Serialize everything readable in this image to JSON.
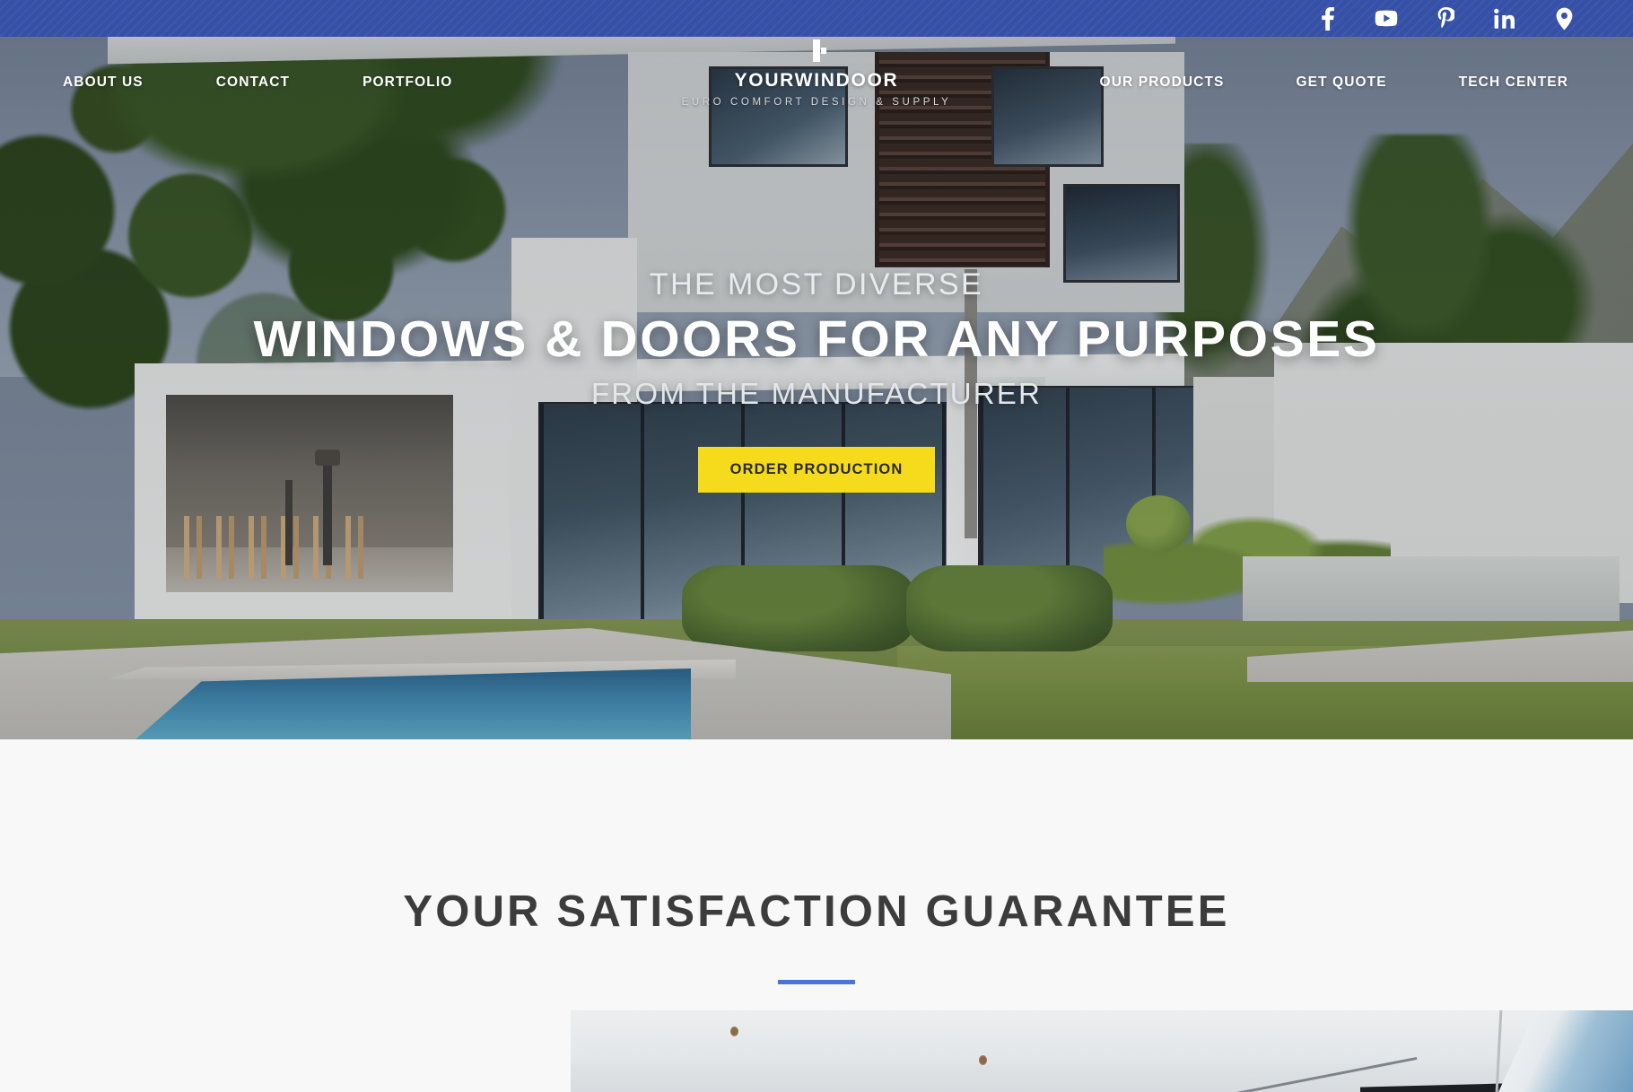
{
  "topbar": {
    "background_color": "#3550A6",
    "social_links": [
      {
        "name": "facebook-icon",
        "label": "Facebook"
      },
      {
        "name": "youtube-icon",
        "label": "YouTube"
      },
      {
        "name": "pinterest-icon",
        "label": "Pinterest"
      },
      {
        "name": "linkedin-icon",
        "label": "LinkedIn"
      },
      {
        "name": "location-pin-icon",
        "label": "Location"
      }
    ]
  },
  "logo": {
    "name": "YOURWINDOOR",
    "tagline": "EURO COMFORT DESIGN & SUPPLY",
    "mark": "window-frame-icon"
  },
  "nav": {
    "left": [
      {
        "label": "ABOUT US"
      },
      {
        "label": "CONTACT"
      },
      {
        "label": "PORTFOLIO"
      }
    ],
    "right": [
      {
        "label": "OUR PRODUCTS"
      },
      {
        "label": "GET QUOTE"
      },
      {
        "label": "TECH CENTER"
      }
    ]
  },
  "hero": {
    "kicker": "THE MOST DIVERSE",
    "title": "WINDOWS & DOORS FOR ANY PURPOSES",
    "subtitle": "FROM THE MANUFACTURER",
    "cta_label": "ORDER PRODUCTION",
    "cta_color": "#F5DB1B",
    "cta_text_color": "#2B2B2B"
  },
  "guarantee_section": {
    "title": "YOUR SATISFACTION GUARANTEE",
    "accent_color": "#4A72DB",
    "background_color": "#F8F8F8"
  }
}
